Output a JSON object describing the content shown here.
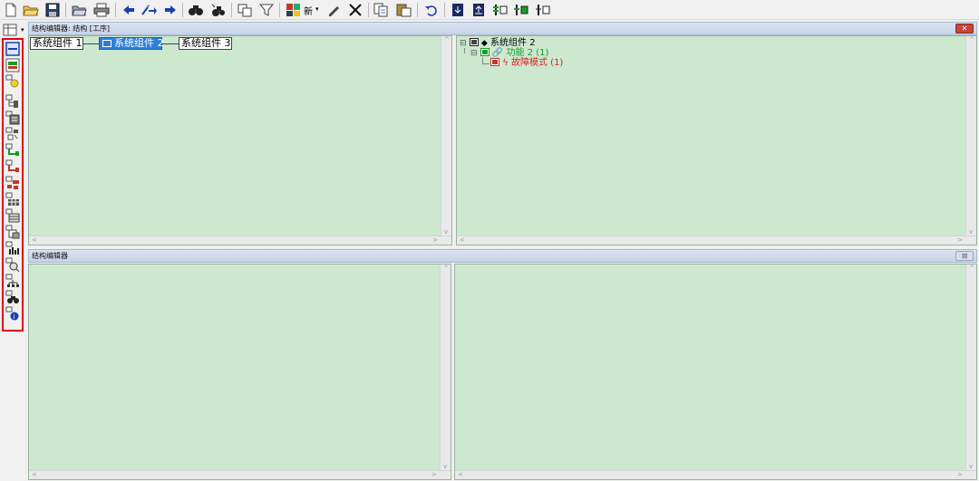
{
  "toolbar": {
    "new_label": "新"
  },
  "top_panel": {
    "title": "结构编辑器: 结构 [工序]",
    "close_label": "✕",
    "nodes": [
      {
        "label": "系统组件 1"
      },
      {
        "label": "系统组件 2"
      },
      {
        "label": "系统组件 3"
      }
    ],
    "tree": {
      "root": "系统组件 2",
      "function": "功能 2 (1)",
      "failure": "故障模式 (1)"
    }
  },
  "bottom_panel": {
    "title": "结构编辑器",
    "close_label": "⊠"
  },
  "colors": {
    "pane_bg": "#cce8cf",
    "selection": "#2f7fd8",
    "function_green": "#1a9a2a",
    "failure_red": "#e02020",
    "highlight_border": "#e3001b"
  }
}
